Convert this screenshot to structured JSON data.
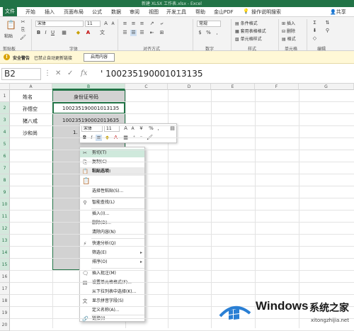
{
  "title": {
    "text": "新建 XLSX 工作表.xlsx - Excel"
  },
  "tabs": [
    "文件",
    "开始",
    "插入",
    "页面布局",
    "公式",
    "数据",
    "审阅",
    "视图",
    "开发工具",
    "帮助",
    "金山PDF",
    "操作说明搜索",
    "共享"
  ],
  "ribbon": {
    "font_name": "宋体",
    "font_size": "11",
    "number_format": "常规",
    "paste": "粘贴",
    "cond_format": "条件格式",
    "table_format": "套用表格格式",
    "cell_style": "单元格样式",
    "insert": "插入",
    "delete": "删除",
    "format": "格式",
    "groups": [
      "剪贴板",
      "字体",
      "对齐方式",
      "数字",
      "样式",
      "单元格",
      "编辑"
    ]
  },
  "warning": {
    "title": "安全警告",
    "text": "已禁止自动更新链接",
    "button": "启用内容"
  },
  "formula_bar": {
    "name_box": "B2",
    "fx": "fx",
    "formula": "' 100235190001013135"
  },
  "columns": [
    "A",
    "B",
    "C",
    "D",
    "E",
    "F",
    "G"
  ],
  "rows": [
    "1",
    "2",
    "3",
    "4",
    "5",
    "6",
    "7",
    "8",
    "9",
    "10",
    "11",
    "12",
    "13",
    "14",
    "15",
    "16",
    "17",
    "18",
    "19",
    "20"
  ],
  "cells": {
    "a1": "姓名",
    "b1": "身份证号码",
    "a2": "孙悟空",
    "b2": "100235190001013135",
    "a3": "猪八戒",
    "b3": "100235190002013635",
    "a4": "沙和尚",
    "b4": "1."
  },
  "mini_toolbar": {
    "font": "宋体",
    "size": "11",
    "percent": "%"
  },
  "context_menu": [
    "剪切(T)",
    "复制(C)",
    "粘贴选项:",
    "选择性粘贴(S)...",
    "智能查找(L)",
    "插入(I)...",
    "删除(D)...",
    "清除内容(N)",
    "快速分析(Q)",
    "筛选(E)",
    "排序(O)",
    "插入批注(M)",
    "设置单元格格式(F)...",
    "从下拉列表中选择(K)...",
    "显示拼音字段(S)",
    "定义名称(A)...",
    "链接(I)"
  ],
  "watermark": {
    "brand": "Windows",
    "site": "系统之家",
    "url": "xitongzhijia.net"
  },
  "colors": {
    "accent": "#217346",
    "warn_bg": "#fff8d6",
    "selection": "#d2d2d2",
    "menu_hover": "#cfe9dc"
  }
}
